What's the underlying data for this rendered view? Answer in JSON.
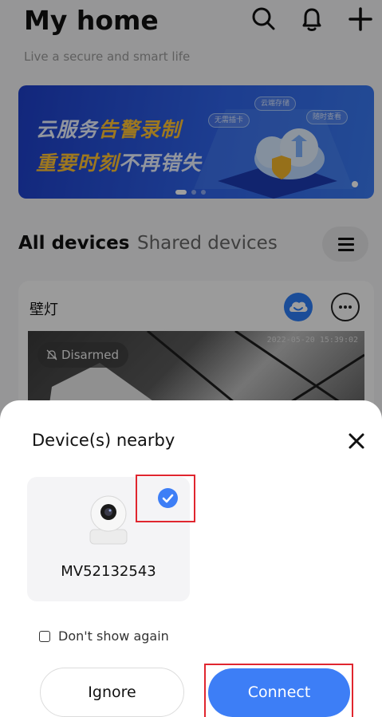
{
  "header": {
    "title": "My home",
    "subtitle": "Live a secure and smart life",
    "icons": [
      "search-icon",
      "bell-icon",
      "plus-icon"
    ]
  },
  "banner": {
    "line1_white": "云服务",
    "line1_yellow": "告警录制",
    "line2_yellow": "重要时刻",
    "line2_white": "不再错失",
    "chips": [
      "云端存储",
      "无需插卡",
      "随时查看"
    ]
  },
  "tabs": {
    "all": "All devices",
    "shared": "Shared devices"
  },
  "device_card": {
    "name": "壁灯",
    "timestamp": "2022-05-20 15:39:02",
    "status": "Disarmed"
  },
  "sheet": {
    "title": "Device(s) nearby",
    "device_name": "MV52132543",
    "dont_show_label": "Don't show again",
    "ignore_label": "Ignore",
    "connect_label": "Connect"
  },
  "colors": {
    "accent": "#3d7ef6",
    "highlight_box": "#e0262f",
    "banner_yellow": "#ffc233"
  }
}
